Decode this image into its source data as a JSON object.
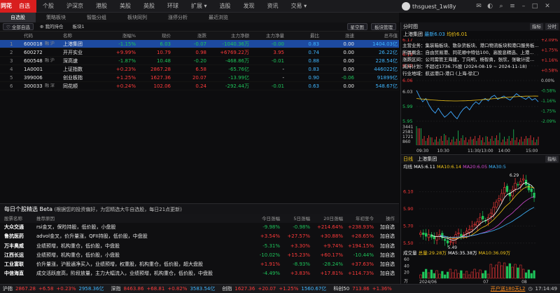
{
  "topbar": {
    "logo": "同花",
    "nav": [
      "自选",
      "个股",
      "沪深京",
      "港股",
      "美股",
      "英股",
      "环球",
      "扩展",
      "选股",
      "发现",
      "资讯",
      "交易"
    ],
    "nav_dropdown_markers": [
      "▾",
      "▾"
    ],
    "user": "thsguest_1wl8y"
  },
  "subtabs": [
    "自选股",
    "策略板块",
    "智能分组",
    "板块同列",
    "涨停分析",
    "最近浏览"
  ],
  "toolbar": {
    "all_watch": "全部自选",
    "my_holdings": "我的持仓",
    "group": "板块1",
    "star_circle": "星空图",
    "board_manage": "板块管理"
  },
  "table": {
    "headers": [
      "",
      "代码",
      "名称",
      "涨幅%",
      "现价",
      "涨跌",
      "主力净额",
      "主力净量",
      "最比",
      "涨速",
      "总市值"
    ],
    "rows": [
      {
        "idx": "1",
        "code": "600018",
        "tag": "融 沪",
        "name": "上港集团",
        "pct": "-1.15%",
        "price": "6.03",
        "chg": "-0.07",
        "net": "-1040.36万",
        "netq": "-0.00",
        "ratio": "0.83",
        "speed": "0.00",
        "cap": "1404.03亿",
        "dir": "down",
        "selected": true
      },
      {
        "idx": "2",
        "code": "600272",
        "tag": "",
        "name": "开开实业",
        "pct": "+9.99%",
        "price": "10.79",
        "chg": "0.98",
        "net": "+6769.22万",
        "netq": "3.95",
        "ratio": "0.74",
        "speed": "0.00",
        "cap": "26.22亿",
        "dir": "up",
        "selected": false
      },
      {
        "idx": "3",
        "code": "600548",
        "tag": "融 沪",
        "name": "深高速",
        "pct": "-1.87%",
        "price": "10.48",
        "chg": "-0.20",
        "net": "-468.86万",
        "netq": "-0.01",
        "ratio": "0.88",
        "speed": "0.00",
        "cap": "228.54亿",
        "dir": "down",
        "selected": false
      },
      {
        "idx": "4",
        "code": "1A0001",
        "tag": "",
        "name": "上证指数",
        "pct": "+0.23%",
        "price": "2867.28",
        "chg": "6.58",
        "net": "-65.76亿",
        "netq": "-",
        "ratio": "0.83",
        "speed": "0.00",
        "cap": "446022亿",
        "dir": "up",
        "selected": false
      },
      {
        "idx": "5",
        "code": "399006",
        "tag": "",
        "name": "创业板指",
        "pct": "+1.25%",
        "price": "1627.36",
        "chg": "20.07",
        "net": "-13.99亿",
        "netq": "-",
        "ratio": "0.90",
        "speed": "-0.06",
        "cap": "91899亿",
        "dir": "up",
        "selected": false
      },
      {
        "idx": "6",
        "code": "300033",
        "tag": "融 深",
        "name": "同花顺",
        "pct": "+0.24%",
        "price": "102.06",
        "chg": "0.24",
        "net": "-292.44万",
        "netq": "-0.01",
        "ratio": "0.63",
        "speed": "0.00",
        "cap": "548.67亿",
        "dir": "up",
        "selected": false
      }
    ]
  },
  "picks": {
    "title": "每日个股精选 Beta",
    "subtitle": "(根据您的投资偏好，为您精选大牛自选股，每日21点更新)",
    "headers": [
      "股票名称",
      "推荐原因",
      "今日涨幅",
      "5日涨幅",
      "20日涨幅",
      "年初至今",
      "操作"
    ],
    "rows": [
      {
        "name": "大众交通",
        "reason": "rsi金叉，保险持股，低价股，小盘股",
        "d1": "-9.98%",
        "d5": "-0.98%",
        "d20": "+214.64%",
        "ytd": "+238.93%",
        "op": "加自选",
        "d1dir": "down",
        "d5dir": "down",
        "d20dir": "up",
        "ytddir": "up"
      },
      {
        "name": "鲁抗医药",
        "reason": "advol金叉，价升量涨，QFII持股，低价股，中盘股",
        "d1": "+3.54%",
        "d5": "+27.57%",
        "d20": "+30.88%",
        "ytd": "+28.65%",
        "op": "加自选",
        "d1dir": "up",
        "d5dir": "up",
        "d20dir": "up",
        "ytddir": "up"
      },
      {
        "name": "万丰奥威",
        "reason": "业绩预增，机构重仓，低价股，中盘股",
        "d1": "-5.31%",
        "d5": "+3.30%",
        "d20": "+9.74%",
        "ytd": "+194.15%",
        "op": "加自选",
        "d1dir": "down",
        "d5dir": "up",
        "d20dir": "up",
        "ytddir": "up"
      },
      {
        "name": "江西长运",
        "reason": "业绩预增，机构重仓，低价股，小盘股",
        "d1": "-10.02%",
        "d5": "+15.23%",
        "d20": "+60.17%",
        "ytd": "-10.44%",
        "op": "加自选",
        "d1dir": "down",
        "d5dir": "up",
        "d20dir": "up",
        "ytddir": "down"
      },
      {
        "name": "工业富联",
        "reason": "价升量涨，沪股通净买入，业绩预增，权重股，机构重仓，低价股，超大盘股",
        "d1": "+1.91%",
        "d5": "-8.93%",
        "d20": "-28.24%",
        "ytd": "+37.63%",
        "op": "加自选",
        "d1dir": "up",
        "d5dir": "down",
        "d20dir": "down",
        "ytddir": "up"
      },
      {
        "name": "中信海直",
        "reason": "成交活跃度高，阶段放量，主力大幅流入，业绩预增，机构重仓，低价股，中盘股",
        "d1": "-4.49%",
        "d5": "+3.83%",
        "d20": "+17.81%",
        "ytd": "+114.73%",
        "op": "加自选",
        "d1dir": "down",
        "d5dir": "up",
        "d20dir": "up",
        "ytddir": "up"
      }
    ]
  },
  "statusbar": {
    "sh_name": "沪指",
    "sh_val": "2867.28",
    "sh_chg": "+6.58",
    "sh_pct": "+0.23%",
    "sh_amt": "2958.36亿",
    "sz_name": "深指",
    "sz_val": "8463.86",
    "sz_chg": "+68.81",
    "sz_pct": "+0.82%",
    "sz_amt": "3583.54亿",
    "cy_name": "创指",
    "cy_val": "1627.36",
    "cy_chg": "+20.07",
    "cy_pct": "+1.25%",
    "cy_amt": "1560.67亿",
    "misc_name": "科创50",
    "misc_val": "713.86",
    "misc_pct": "+1.36%",
    "notice": "开户送180天L2",
    "time": "17:14:49"
  },
  "intraday": {
    "title": "分时图",
    "menu": "指标",
    "view": "分时",
    "stock": "上港集团",
    "price_label": "最新6.03",
    "avg_label": "均价6.01",
    "info_lines": [
      "主营业务：集装箱板块、散杂货板块、港口物流板块和港口服务板...",
      "所属概念：自由贸易港、同花顺中特估100、高股息精选、上港...",
      "涨跌区间：公司需管王海建，丁向明，杨智勇，张欣，张敏计提...",
      "减持计划：不超过1736.75股 (2024-08-19 ~ 2024-11-18)",
      "行业地域：航运港口-港口 (上海-徐汇)"
    ],
    "y_left": [
      "6.17",
      "6.13",
      "6.10",
      "6.06",
      "6.03",
      "5.99",
      "5.95"
    ],
    "y_right": [
      "+2.09%",
      "+1.75%",
      "+1.16%",
      "+0.58%",
      "0.00%",
      "-0.58%",
      "-1.16%",
      "-1.75%",
      "-2.09%"
    ],
    "vol_labels": [
      "3441",
      "2581",
      "1721",
      "860"
    ],
    "time_ticks": [
      "09:30",
      "10:30",
      "11:30/13:00",
      "14:00",
      "15:00"
    ]
  },
  "kline": {
    "title": "日线",
    "stock": "上港集团",
    "ma_type": "均线",
    "ma5": "MA5:6.11",
    "ma10": "MA10:6.14",
    "ma20": "MA20:6.05",
    "ma30": "MA30:5",
    "menu": "指标",
    "high_label": "6.29",
    "low_label": "5.49",
    "y_labels": [
      "6.10",
      "5.90",
      "5.70",
      "5.50"
    ],
    "vol_title": "成交量",
    "vol_total": "总量:29.28万",
    "vol_ma5": "MA5:35.38万",
    "vol_ma10": "MA10:36.09万",
    "vol_y": [
      "60",
      "40",
      "20"
    ],
    "vol_unit": "万",
    "x_labels": [
      "2024/06",
      "07",
      "08"
    ],
    "colors": {
      "ma5": "#ffffff",
      "ma10": "#f0c419",
      "ma20": "#d24bd2",
      "ma30": "#3fb6ff"
    }
  }
}
